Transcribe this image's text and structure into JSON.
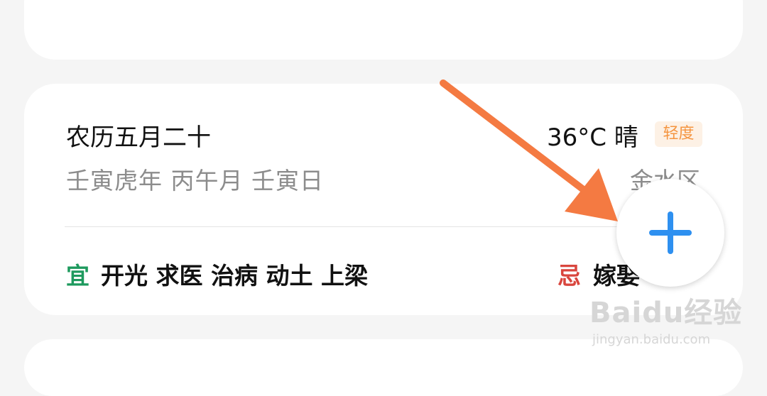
{
  "almanac": {
    "lunar_date": "农历五月二十",
    "ganzhi": "壬寅虎年 丙午月 壬寅日",
    "weather": "36°C 晴",
    "aqi_badge": "轻度",
    "district": "金水区",
    "yi_label": "宜",
    "yi_items": "开光 求医 治病 动土 上梁",
    "ji_label": "忌",
    "ji_items": "嫁娶"
  },
  "fab": {
    "icon": "plus-icon"
  },
  "annotation": {
    "arrow_color": "#f47a42"
  },
  "watermark": {
    "brand": "Baidu经验",
    "url": "jingyan.baidu.com"
  },
  "colors": {
    "yi": "#1e9a5e",
    "ji": "#d9463e",
    "accent_blue": "#2e90f0",
    "badge_text": "#f59540",
    "badge_bg": "#fdf1e5"
  }
}
